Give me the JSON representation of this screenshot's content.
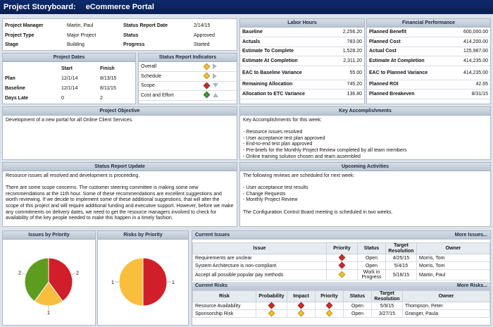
{
  "app": {
    "title": "Project Storyboard:",
    "subtitle": "eCommerce Portal"
  },
  "info": {
    "rows": [
      {
        "l1": "Project Manager",
        "v1": "Martin, Paul",
        "l2": "Status Report Date",
        "v2": "2/14/15"
      },
      {
        "l1": "Project Type",
        "v1": "Major Project",
        "l2": "Status",
        "v2": "Approved"
      },
      {
        "l1": "Stage",
        "v1": "Building",
        "l2": "Progress",
        "v2": "Started"
      }
    ]
  },
  "labor": {
    "title": "Labor Hours",
    "rows": [
      {
        "label": "Baseline",
        "value": "2,256.20"
      },
      {
        "label": "Actuals",
        "value": "783.00"
      },
      {
        "label": "Estimate To Complete",
        "value": "1,528.20"
      },
      {
        "label": "Estimate At Completion",
        "value": "2,311.20"
      },
      {
        "label": "EAC to Baseline Variance",
        "value": "55.00"
      },
      {
        "label": "Remaining Allocation",
        "value": "745.20"
      },
      {
        "label": "Allocation to ETC Variance",
        "value": "136.80"
      }
    ]
  },
  "financial": {
    "title": "Financial Performance",
    "rows": [
      {
        "label": "Planned Benefit",
        "value": "600,000.00"
      },
      {
        "label": "Planned Cost",
        "value": "414,200.00"
      },
      {
        "label": "Actual Cost",
        "value": "125,987.00"
      },
      {
        "label": "Estimate At Completion",
        "value": "414,235.00"
      },
      {
        "label": "EAC to Planned Variance",
        "value": "414,235.00"
      },
      {
        "label": "Planned ROI",
        "value": "42.65"
      },
      {
        "label": "Planned Breakeven",
        "value": "8/31/15"
      }
    ]
  },
  "dates": {
    "title": "Project Dates",
    "col_start": "Start",
    "col_finish": "Finish",
    "rows": [
      {
        "label": "Plan",
        "start": "12/1/14",
        "finish": "8/13/15"
      },
      {
        "label": "Baseline",
        "start": "12/1/14",
        "finish": "8/11/15"
      },
      {
        "label": "Days Late",
        "start": "0",
        "finish": "2"
      }
    ]
  },
  "indicators": {
    "title": "Status Report Indicators",
    "rows": [
      {
        "label": "Overall",
        "color": "y",
        "trend": "right"
      },
      {
        "label": "Schedule",
        "color": "y",
        "trend": "right"
      },
      {
        "label": "Scope",
        "color": "rd",
        "trend": "down"
      },
      {
        "label": "Cost and Effort",
        "color": "g",
        "trend": "up"
      }
    ]
  },
  "objective": {
    "title": "Project Objective",
    "text": "Development of a new portal for all Online Client Services."
  },
  "accomplishments": {
    "title": "Key Accomplishments",
    "text": "Key Accomplishments for this week:\n\n- Resource issues resolved\n- User acceptance test plan approved\n- End-to-end test plan approved\n- Pre-briefs for the Monthly Project Review completed by all team members\n- Online training solution chosen and team assembled"
  },
  "update": {
    "title": "Status Report Update",
    "text": "Resource issues all resolved and development is proceeding.\n\nThere are some scope concerns. The customer steering committee is making some new recommendations at the 11th hour. Some of these recommendations are excellent suggestions and worth reviewing. If we decide to implement some of these additional suggestions, that will alter the scope of this project and will require additional funding and executive support. However, before we make any commitments on delivery dates, we need to get the resource managers involved to check for availability of the key people needed to make this happen in a timely fashion."
  },
  "upcoming": {
    "title": "Upcoming Activities",
    "text": "The following reviews are scheduled for next week:\n\n- User acceptance test results\n- Change Requests\n- Monthly Project Review\n\nThe Configuration Control Board meeting is scheduled in two weeks."
  },
  "issues_chart": {
    "title": "Issues by Priority"
  },
  "risks_chart": {
    "title": "Risks by Priority"
  },
  "chart_data": [
    {
      "type": "pie",
      "title": "Issues by Priority",
      "slices": [
        {
          "value": 2,
          "color": "#d01f2b"
        },
        {
          "value": 1,
          "color": "#f8be3c"
        },
        {
          "value": 2,
          "color": "#5d9c1f"
        }
      ],
      "labels": [
        "2",
        "1",
        "2"
      ]
    },
    {
      "type": "pie",
      "title": "Risks by Priority",
      "slices": [
        {
          "value": 1,
          "color": "#d01f2b"
        },
        {
          "value": 1,
          "color": "#f8be3c"
        }
      ],
      "labels": [
        "1",
        "1"
      ]
    }
  ],
  "issues": {
    "title": "Current Issues",
    "more": "More Issues...",
    "headers": [
      "Issue",
      "Priority",
      "Status",
      "Target Resolution",
      "Owner"
    ],
    "rows": [
      {
        "issue": "Requirements are unclear",
        "priority": "rd",
        "status": "Open",
        "target": "4/25/15",
        "owner": "Morris, Tom"
      },
      {
        "issue": "System Architecture is non-compliant",
        "priority": "rd",
        "status": "Open",
        "target": "5/4/15",
        "owner": "Morris, Tom"
      },
      {
        "issue": "Accept all possible popular pay methods",
        "priority": "y",
        "status": "Work in Progress",
        "target": "5/18/15",
        "owner": "Martin, Paul"
      }
    ]
  },
  "risks": {
    "title": "Current Risks",
    "more": "More Risks...",
    "headers": [
      "Risk",
      "Probability",
      "Impact",
      "Priority",
      "Status",
      "Target Resolution",
      "Owner"
    ],
    "rows": [
      {
        "risk": "Resource Availability",
        "prob": "rd",
        "impact": "rd",
        "priority": "rd",
        "status": "Open",
        "target": "5/9/15",
        "owner": "Thompson, Peter"
      },
      {
        "risk": "Sponsorship Risk",
        "prob": "y",
        "impact": "y",
        "priority": "y",
        "status": "Open",
        "target": "3/27/15",
        "owner": "Granger, Paula"
      }
    ]
  }
}
